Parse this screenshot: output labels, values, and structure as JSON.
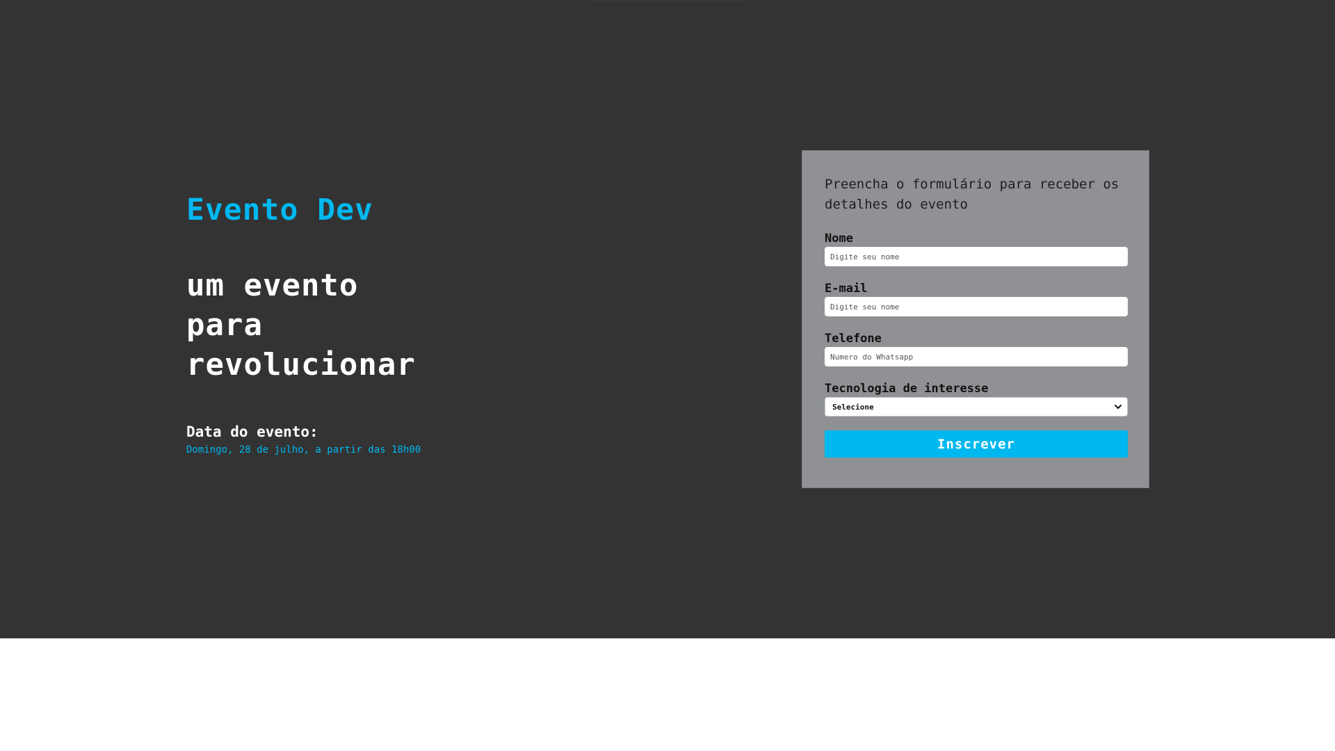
{
  "page": {
    "background_dark": "#333333",
    "background_light": "#ffffff",
    "accent_color": "#00b8f0",
    "form_bg": "#8f9194"
  },
  "hero": {
    "brand": "Evento Dev",
    "tagline": [
      "um evento",
      "para",
      "revolucionar"
    ],
    "date_label": "Data do evento:",
    "date_value": "Domingo, 28 de julho, a partir das 18h00"
  },
  "form": {
    "title": "Preencha o formulário para receber os detalhes do evento",
    "fields": [
      {
        "label": "Nome",
        "placeholder": "Digite seu nome"
      },
      {
        "label": "E-mail",
        "placeholder": "Digite seu nome"
      },
      {
        "label": "Telefone",
        "placeholder": "Numero do Whatsapp"
      }
    ],
    "select": {
      "label": "Tecnologia de interesse",
      "selected": "Selecione"
    },
    "submit_label": "Inscrever"
  }
}
